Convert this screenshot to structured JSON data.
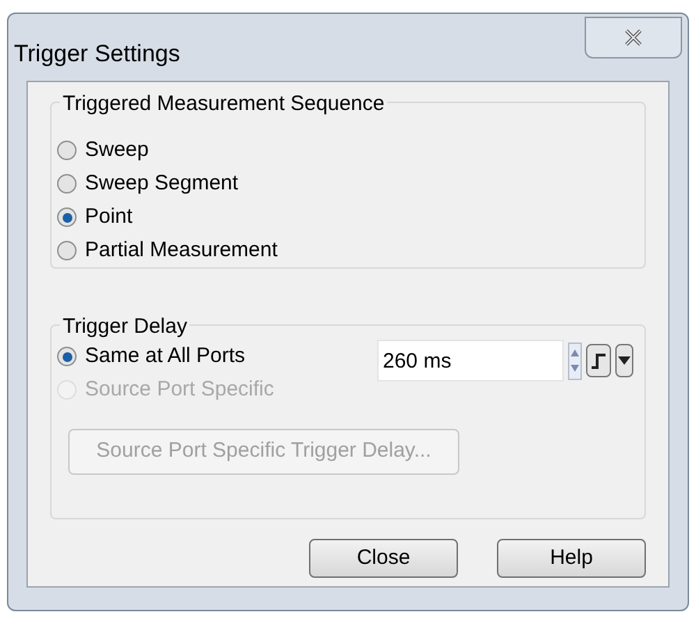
{
  "window": {
    "title": "Trigger Settings"
  },
  "sequence": {
    "title": "Triggered Measurement Sequence",
    "options": [
      {
        "label": "Sweep",
        "selected": false,
        "disabled": false
      },
      {
        "label": "Sweep Segment",
        "selected": false,
        "disabled": false
      },
      {
        "label": "Point",
        "selected": true,
        "disabled": false
      },
      {
        "label": "Partial Measurement",
        "selected": false,
        "disabled": false
      }
    ]
  },
  "delay": {
    "title": "Trigger Delay",
    "options": [
      {
        "label": "Same at All Ports",
        "selected": true,
        "disabled": false
      },
      {
        "label": "Source Port Specific",
        "selected": false,
        "disabled": true
      }
    ],
    "value": "260 ms"
  },
  "source_button": {
    "label": "Source Port Specific Trigger Delay...",
    "disabled": true
  },
  "buttons": [
    "Close",
    "Help"
  ]
}
